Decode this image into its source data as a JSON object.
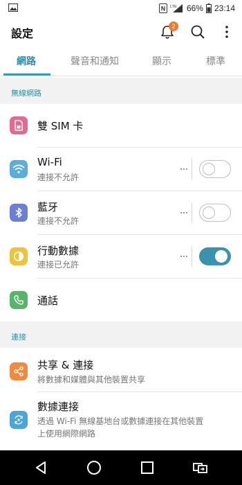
{
  "status_bar": {
    "battery_percent": "66%",
    "time": "23:14",
    "network_label": "LTE",
    "nfc_label": "N"
  },
  "app_bar": {
    "title": "設定",
    "notification_count": "2"
  },
  "tabs": [
    {
      "label": "網路",
      "active": true
    },
    {
      "label": "聲音和通知",
      "active": false
    },
    {
      "label": "顯示",
      "active": false
    },
    {
      "label": "標準",
      "active": false
    }
  ],
  "sections": {
    "wireless": {
      "header": "無線網路",
      "items": [
        {
          "title": "雙 SIM 卡",
          "icon": "sim-card-icon",
          "color": "#e26a8f"
        },
        {
          "title": "Wi-Fi",
          "subtitle": "連接不允許",
          "icon": "wifi-icon",
          "color": "#5aaedc",
          "toggle": false
        },
        {
          "title": "藍牙",
          "subtitle": "連接不允許",
          "icon": "bluetooth-icon",
          "color": "#6c7fd6",
          "toggle": false
        },
        {
          "title": "行動數據",
          "subtitle": "連接已允許",
          "icon": "mobile-data-icon",
          "color": "#f0c33c",
          "toggle": true
        },
        {
          "title": "通話",
          "icon": "phone-icon",
          "color": "#57b56a"
        }
      ]
    },
    "connection": {
      "header": "連接",
      "items": [
        {
          "title": "共享 & 連接",
          "subtitle": "將數據和媒體與其他裝置共享",
          "icon": "share-icon",
          "color": "#f08a3d"
        },
        {
          "title": "數據連接",
          "subtitle": "透過 Wi-Fi 無線基地台或數據連接在其他裝置",
          "subtitle2": "上使用網際網路",
          "icon": "tethering-icon",
          "color": "#4aa6d8"
        }
      ]
    }
  },
  "colors": {
    "accent": "#2f9cb5",
    "toggle_on": "#3a93ad",
    "section_bg": "#f2f2f2"
  }
}
